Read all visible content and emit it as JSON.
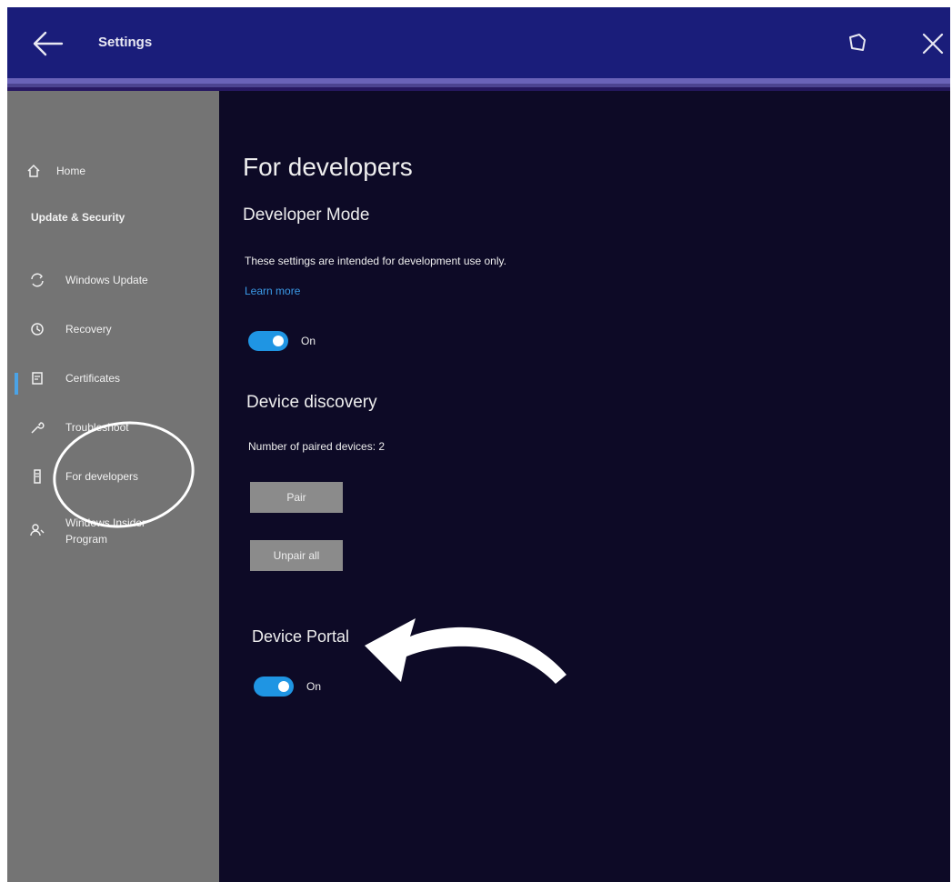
{
  "window": {
    "title": "Settings",
    "back_icon": "back-arrow-icon",
    "tile_icon": "tile-icon",
    "close_icon": "close-icon"
  },
  "sidebar": {
    "home": {
      "label": "Home",
      "icon": "home-icon"
    },
    "heading": "Update & Security",
    "items": [
      {
        "label": "Windows Update",
        "icon": "sync-icon"
      },
      {
        "label": "Recovery",
        "icon": "history-icon"
      },
      {
        "label": "Certificates",
        "icon": "certificate-icon"
      },
      {
        "label": "Troubleshoot",
        "icon": "wrench-icon"
      },
      {
        "label": "For developers",
        "icon": "developer-icon"
      },
      {
        "label": "Windows Insider Program",
        "icon": "insider-icon"
      }
    ]
  },
  "main": {
    "page_title": "For developers",
    "developer_mode": {
      "title": "Developer Mode",
      "description": "These settings are intended for development use only.",
      "learn_more": "Learn more",
      "toggle_label": "On"
    },
    "device_discovery": {
      "title": "Device discovery",
      "paired_text": "Number of paired devices: 2",
      "pair_button": "Pair",
      "unpair_button": "Unpair all"
    },
    "device_portal": {
      "title": "Device Portal",
      "toggle_label": "On"
    }
  },
  "colors": {
    "titlebar": "#1a1d7a",
    "sidebar": "#747474",
    "content_bg": "#0d0a26",
    "toggle_on": "#1f95e3",
    "link": "#3b9be8"
  }
}
